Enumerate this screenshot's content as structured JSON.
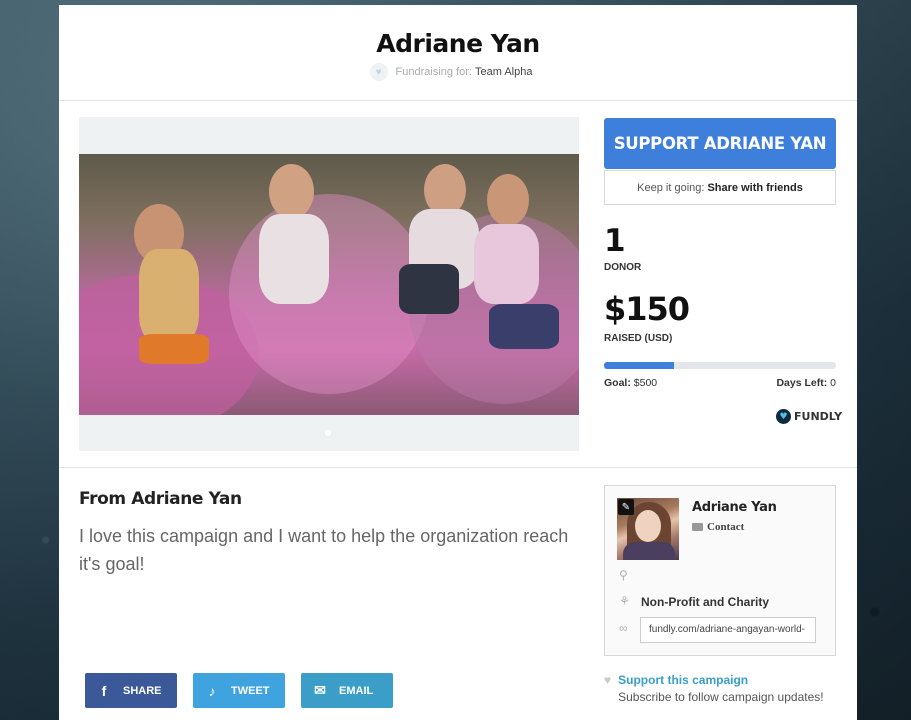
{
  "page": {
    "fundraiser_name": "Adriane Yan",
    "fundraising_for_label": "Fundraising for:",
    "team_name": "Team Alpha"
  },
  "sidebar": {
    "support_button": "SUPPORT ADRIANE YAN",
    "share_prefix": "Keep it going:",
    "share_link": "Share with friends",
    "donor_count": "1",
    "donor_label": "DONOR",
    "raised_amount": "$150",
    "raised_label": "RAISED (USD)",
    "progress_fraction": 0.3,
    "goal_label": "Goal:",
    "goal_value": "$500",
    "days_label": "Days Left:",
    "days_value": "0",
    "brand": "FUNDLY"
  },
  "story": {
    "title": "From Adriane Yan",
    "body": "I love this campaign and I want to help the organization reach it's goal!"
  },
  "social": {
    "share": "SHARE",
    "tweet": "TWEET",
    "email": "EMAIL"
  },
  "profile": {
    "name": "Adriane Yan",
    "contact": "Contact",
    "category": "Non-Profit and Charity",
    "url": "fundly.com/adriane-angayan-world-"
  },
  "follow": {
    "title": "Support this campaign",
    "subtitle": "Subscribe to follow campaign updates!"
  },
  "colors": {
    "accent": "#3f7fdc",
    "facebook": "#3b5998",
    "twitter": "#3fa3e0",
    "email": "#3a9ec9"
  }
}
